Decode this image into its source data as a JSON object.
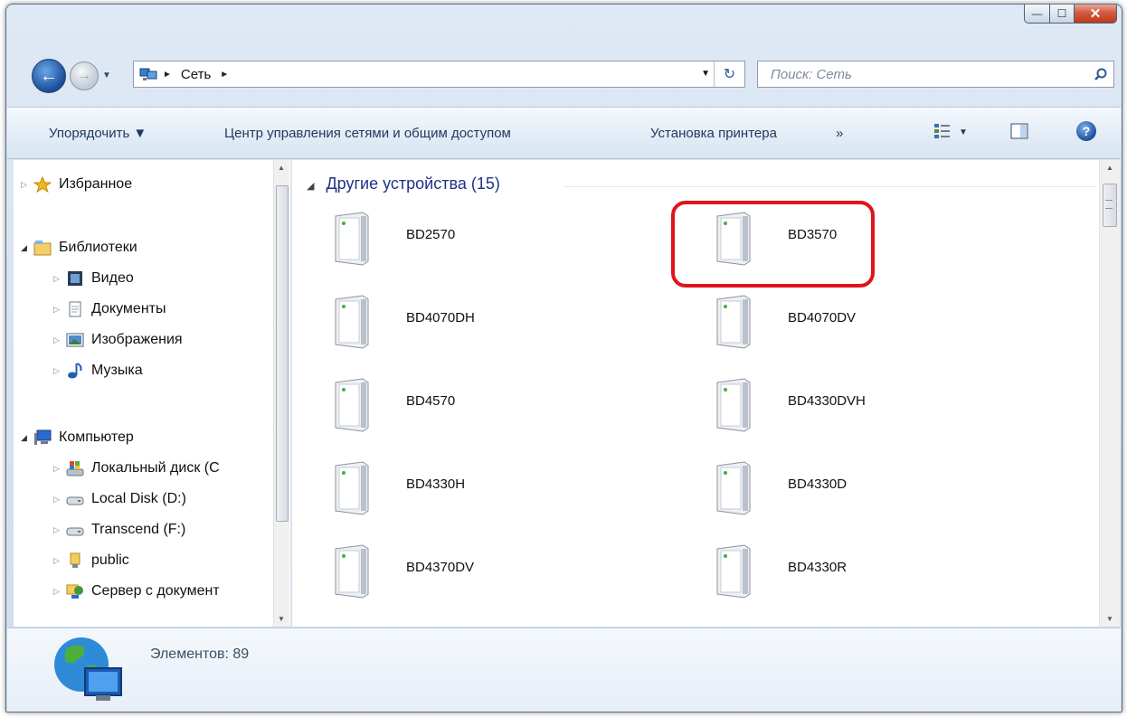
{
  "window": {
    "minimize_glyph": "—",
    "maximize_glyph": "☐",
    "close_glyph": "✕"
  },
  "nav": {
    "back_glyph": "←",
    "forward_glyph": "→",
    "dropdown_glyph": "▼"
  },
  "address": {
    "crumbs": [
      "Сеть"
    ],
    "refresh_glyph": "↻"
  },
  "search": {
    "placeholder": "Поиск: Сеть"
  },
  "toolbar": {
    "organize": "Упорядочить ▼",
    "network_center": "Центр управления сетями и общим доступом",
    "add_printer": "Установка принтера",
    "more": "»",
    "view_dropdown": "▼",
    "help": "?"
  },
  "sidebar": {
    "favorites": "Избранное",
    "libraries": "Библиотеки",
    "video": "Видео",
    "documents": "Документы",
    "images": "Изображения",
    "music": "Музыка",
    "computer": "Компьютер",
    "local_c": "Локальный диск (С",
    "local_d": "Local Disk (D:)",
    "transcend": "Transcend (F:)",
    "public": "public",
    "server": "Сервер с документ"
  },
  "content": {
    "group_header": "Другие устройства (15)",
    "devices": [
      "BD2570",
      "BD3570",
      "BD4070DH",
      "BD4070DV",
      "BD4570",
      "BD4330DVH",
      "BD4330H",
      "BD4330D",
      "BD4370DV",
      "BD4330R"
    ]
  },
  "details": {
    "count_text": "Элементов: 89"
  },
  "colors": {
    "highlight": "#e0141b",
    "group_header": "#1e3287",
    "toolbar_text": "#1e395b"
  },
  "icons": [
    "back-arrow-icon",
    "forward-arrow-icon",
    "network-icon",
    "refresh-icon",
    "search-icon",
    "view-options-icon",
    "preview-pane-icon",
    "help-icon",
    "star-icon",
    "library-icon",
    "video-icon",
    "document-icon",
    "image-icon",
    "music-icon",
    "computer-icon",
    "drive-icon",
    "folder-icon",
    "network-share-icon",
    "server-device-icon",
    "network-globe-icon"
  ]
}
